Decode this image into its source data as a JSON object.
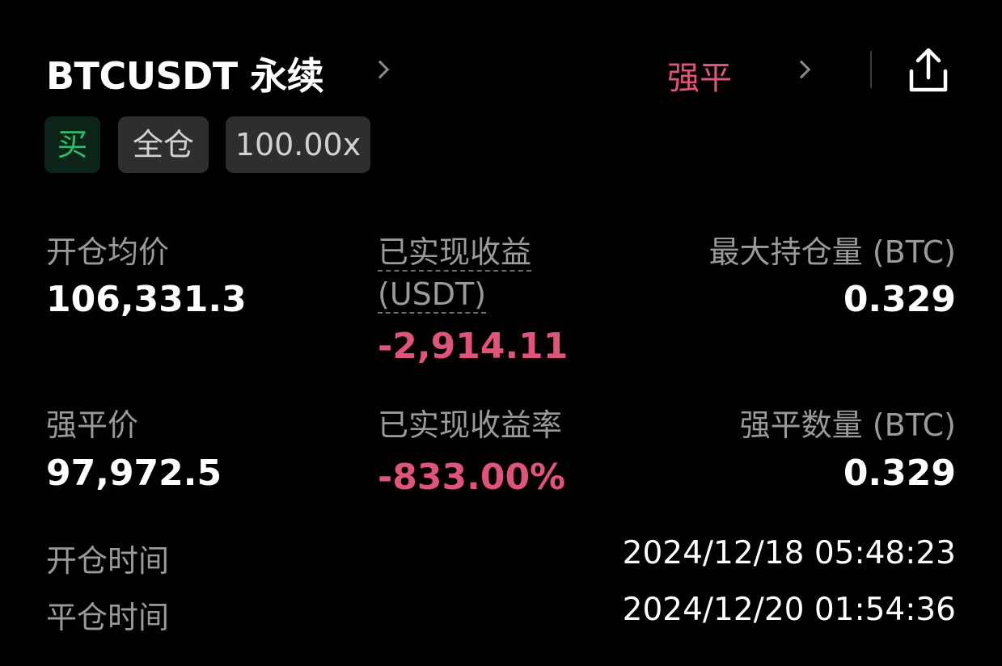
{
  "header": {
    "title": "BTCUSDT 永续",
    "status_tag": "强平"
  },
  "tags": {
    "side": "买",
    "margin_mode": "全仓",
    "leverage": "100.00x"
  },
  "stats": {
    "avg_open_price": {
      "label": "开仓均价",
      "value": "106,331.3"
    },
    "realized_pnl": {
      "label_line1": "已实现收益",
      "label_line2": "(USDT)",
      "value": "-2,914.11"
    },
    "max_position": {
      "label": "最大持仓量 (BTC)",
      "value": "0.329"
    },
    "liq_price": {
      "label": "强平价",
      "value": "97,972.5"
    },
    "realized_pnl_rate": {
      "label": "已实现收益率",
      "value": "-833.00%"
    },
    "liq_quantity": {
      "label": "强平数量 (BTC)",
      "value": "0.329"
    }
  },
  "times": {
    "open_time": {
      "label": "开仓时间",
      "value": "2024/12/18 05:48:23"
    },
    "close_time": {
      "label": "平仓时间",
      "value": "2024/12/20 01:54:36"
    }
  },
  "colors": {
    "background": "#000000",
    "loss": "#e0547a",
    "buy": "#2ebd6b",
    "label": "#9a9a9a"
  },
  "icons": {
    "title_chevron": "chevron-right-icon",
    "status_chevron": "chevron-right-icon",
    "share": "share-icon"
  }
}
